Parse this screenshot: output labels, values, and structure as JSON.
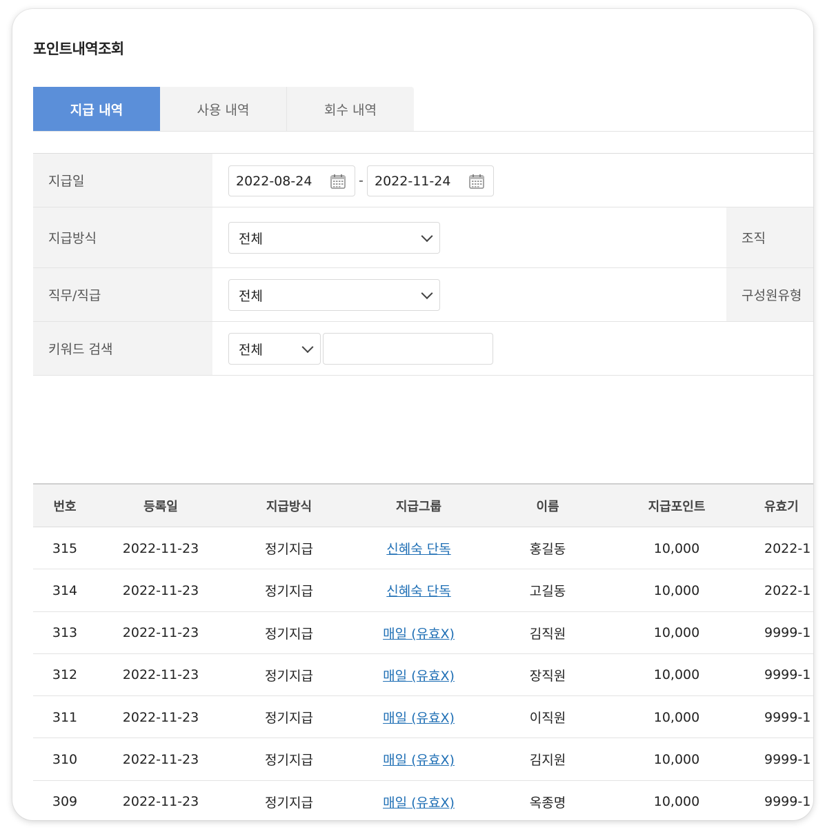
{
  "page": {
    "title": "포인트내역조회"
  },
  "tabs": [
    {
      "label": "지급 내역",
      "active": true
    },
    {
      "label": "사용 내역",
      "active": false
    },
    {
      "label": "회수 내역",
      "active": false
    }
  ],
  "filters": {
    "pay_date": {
      "label": "지급일",
      "from": "2022-08-24",
      "to": "2022-11-24",
      "separator": "-"
    },
    "pay_method": {
      "label": "지급방식",
      "value": "전체"
    },
    "org": {
      "label": "조직"
    },
    "job": {
      "label": "직무/직급",
      "value": "전체"
    },
    "member_type": {
      "label": "구성원유형"
    },
    "keyword": {
      "label": "키워드 검색",
      "scope": "전체",
      "value": ""
    }
  },
  "table": {
    "headers": [
      "번호",
      "등록일",
      "지급방식",
      "지급그룹",
      "이름",
      "지급포인트",
      "유효기"
    ],
    "rows": [
      {
        "no": "315",
        "date": "2022-11-23",
        "method": "정기지급",
        "group": "신혜숙 단독",
        "name": "홍길동",
        "points": "10,000",
        "valid": "2022-1"
      },
      {
        "no": "314",
        "date": "2022-11-23",
        "method": "정기지급",
        "group": "신혜숙 단독",
        "name": "고길동",
        "points": "10,000",
        "valid": "2022-1"
      },
      {
        "no": "313",
        "date": "2022-11-23",
        "method": "정기지급",
        "group": "매일 (유효X)",
        "name": "김직원",
        "points": "10,000",
        "valid": "9999-1"
      },
      {
        "no": "312",
        "date": "2022-11-23",
        "method": "정기지급",
        "group": "매일 (유효X)",
        "name": "장직원",
        "points": "10,000",
        "valid": "9999-1"
      },
      {
        "no": "311",
        "date": "2022-11-23",
        "method": "정기지급",
        "group": "매일 (유효X)",
        "name": "이직원",
        "points": "10,000",
        "valid": "9999-1"
      },
      {
        "no": "310",
        "date": "2022-11-23",
        "method": "정기지급",
        "group": "매일 (유효X)",
        "name": "김지원",
        "points": "10,000",
        "valid": "9999-1"
      },
      {
        "no": "309",
        "date": "2022-11-23",
        "method": "정기지급",
        "group": "매일 (유효X)",
        "name": "옥종명",
        "points": "10,000",
        "valid": "9999-1"
      }
    ]
  },
  "colors": {
    "tab_active": "#5b8fd9",
    "link": "#1f6fb5",
    "label_bg": "#f3f3f3"
  },
  "icons": {
    "date_picker": "calendar-icon",
    "dropdown": "chevron-down-icon"
  }
}
